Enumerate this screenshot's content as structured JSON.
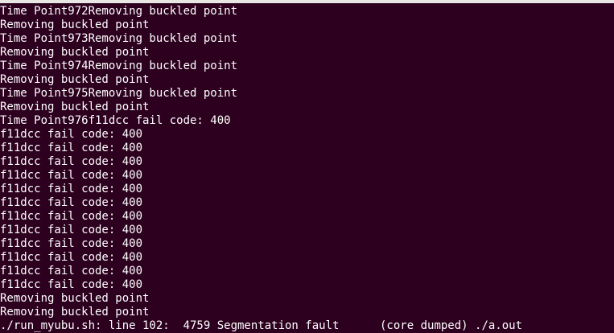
{
  "terminal": {
    "lines": [
      "Time Point972Removing buckled point",
      "Removing buckled point",
      "Time Point973Removing buckled point",
      "Removing buckled point",
      "Time Point974Removing buckled point",
      "Removing buckled point",
      "Time Point975Removing buckled point",
      "Removing buckled point",
      "Time Point976f11dcc fail code: 400",
      "f11dcc fail code: 400",
      "f11dcc fail code: 400",
      "f11dcc fail code: 400",
      "f11dcc fail code: 400",
      "f11dcc fail code: 400",
      "f11dcc fail code: 400",
      "f11dcc fail code: 400",
      "f11dcc fail code: 400",
      "f11dcc fail code: 400",
      "f11dcc fail code: 400",
      "f11dcc fail code: 400",
      "f11dcc fail code: 400",
      "Removing buckled point",
      "Removing buckled point",
      "./run_myubu.sh: line 102:  4759 Segmentation fault      (core dumped) ./a.out"
    ]
  }
}
